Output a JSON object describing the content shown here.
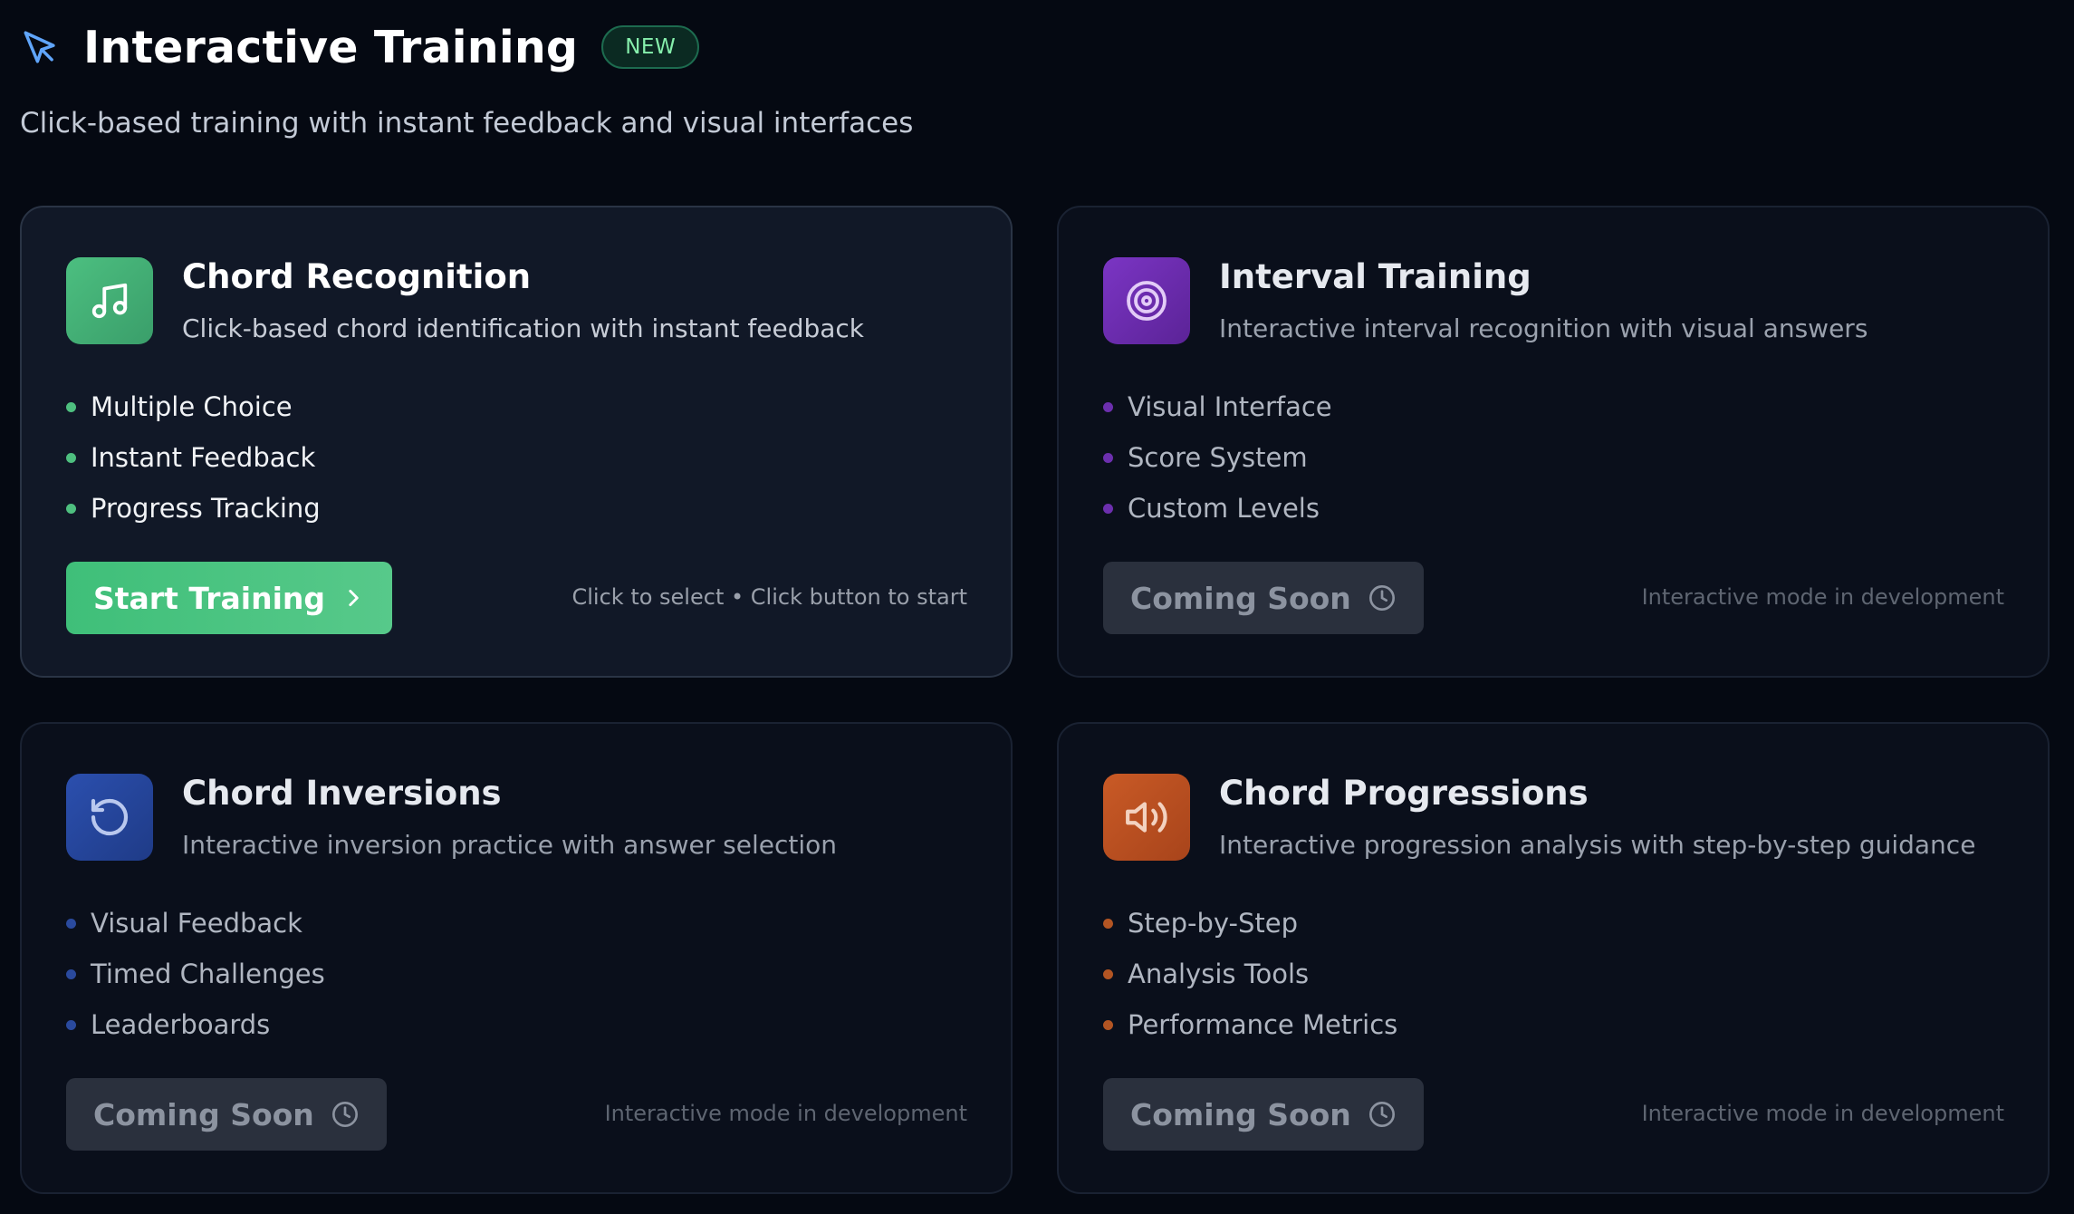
{
  "header": {
    "title": "Interactive Training",
    "badge": "NEW",
    "subtitle": "Click-based training with instant feedback and visual interfaces",
    "icon": "cursor-arrow-icon"
  },
  "cards": [
    {
      "title": "Chord Recognition",
      "description": "Click-based chord identification with instant feedback",
      "icon": "music-note-icon",
      "accent": "#4ebf7f",
      "features": [
        "Multiple Choice",
        "Instant Feedback",
        "Progress Tracking"
      ],
      "button": "Start Training",
      "hint": "Click to select • Click button to start"
    },
    {
      "title": "Interval Training",
      "description": "Interactive interval recognition with visual answers",
      "icon": "target-icon",
      "accent": "#7e3cc6",
      "features": [
        "Visual Interface",
        "Score System",
        "Custom Levels"
      ],
      "button": "Coming Soon",
      "hint": "Interactive mode in development"
    },
    {
      "title": "Chord Inversions",
      "description": "Interactive inversion practice with answer selection",
      "icon": "rotate-ccw-icon",
      "accent": "#2f55b7",
      "features": [
        "Visual Feedback",
        "Timed Challenges",
        "Leaderboards"
      ],
      "button": "Coming Soon",
      "hint": "Interactive mode in development"
    },
    {
      "title": "Chord Progressions",
      "description": "Interactive progression analysis with step-by-step guidance",
      "icon": "speaker-volume-icon",
      "accent": "#d2622a",
      "features": [
        "Step-by-Step",
        "Analysis Tools",
        "Performance Metrics"
      ],
      "button": "Coming Soon",
      "hint": "Interactive mode in development"
    }
  ]
}
